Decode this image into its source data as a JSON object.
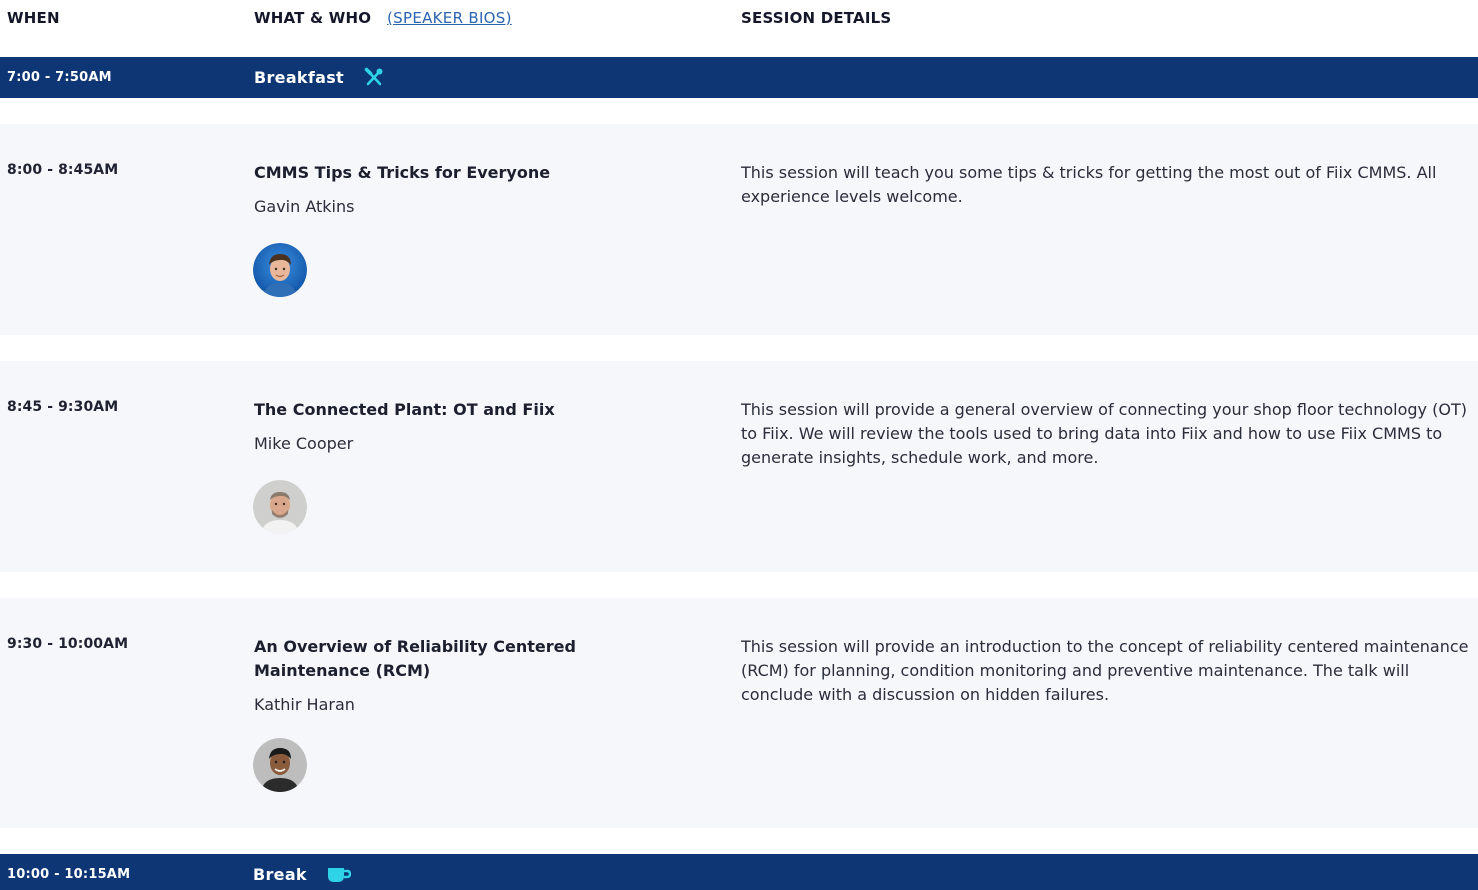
{
  "header": {
    "when": "WHEN",
    "what_who": "WHAT & WHO",
    "speaker_bios": "(SPEAKER BIOS)",
    "session_details": "SESSION DETAILS"
  },
  "breakfast": {
    "time": "7:00 - 7:50AM",
    "title": "Breakfast",
    "icon": "utensils-icon"
  },
  "sessions": [
    {
      "time": "8:00 - 8:45AM",
      "title": "CMMS Tips & Tricks for Everyone",
      "speaker": "Gavin Atkins",
      "details": "This session will teach you some tips & tricks for getting the most out of Fiix CMMS. All experience levels welcome."
    },
    {
      "time": "8:45 - 9:30AM",
      "title": "The Connected Plant: OT and Fiix",
      "speaker": "Mike Cooper",
      "details": "This session will provide a general overview of connecting your shop floor technology (OT) to Fiix. We will review the tools used to bring data into Fiix and how to use Fiix CMMS to generate insights, schedule work, and more."
    },
    {
      "time": "9:30 - 10:00AM",
      "title": "An Overview of Reliability Centered Maintenance (RCM)",
      "speaker": "Kathir Haran",
      "details": "This session will provide an introduction to the concept of reliability centered maintenance (RCM) for planning, condition monitoring and preventive maintenance. The talk will conclude with a discussion on hidden failures."
    }
  ],
  "break": {
    "time": "10:00 - 10:15AM",
    "title": "Break",
    "icon": "coffee-cup-icon"
  },
  "colors": {
    "band": "#0e3675",
    "row_bg": "#f5f7fb",
    "accent_icon": "#2fd3e8",
    "link": "#2c64b0"
  }
}
